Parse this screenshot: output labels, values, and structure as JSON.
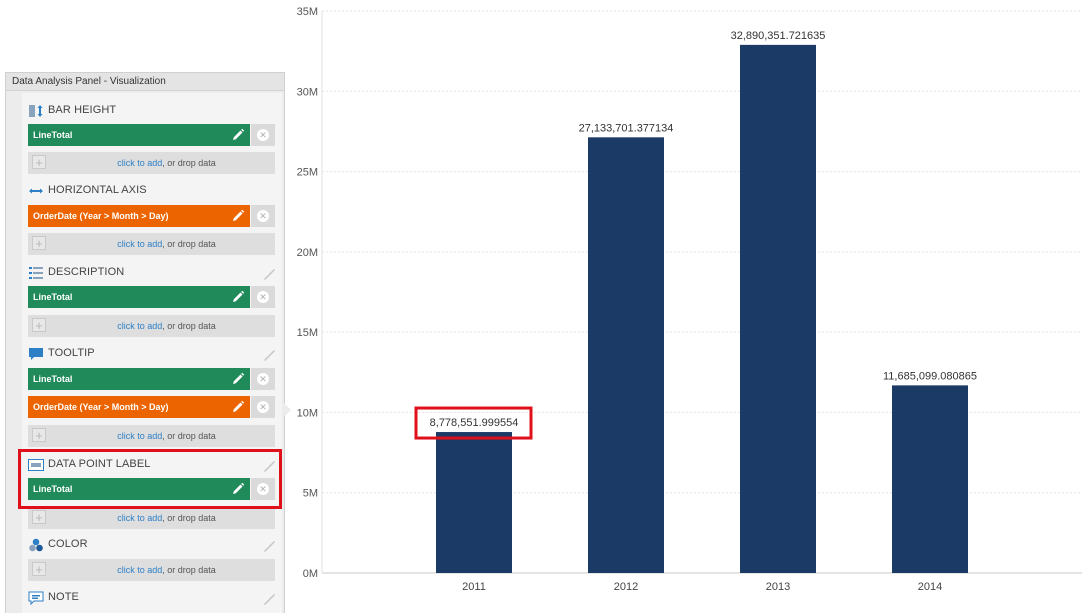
{
  "chart_data": {
    "type": "bar",
    "categories": [
      "2011",
      "2012",
      "2013",
      "2014"
    ],
    "values": [
      8778551.999554,
      27133701.377134,
      32890351.721635,
      11685099.080865
    ],
    "value_labels": [
      "8,778,551.999554",
      "27,133,701.377134",
      "32,890,351.721635",
      "11,685,099.080865"
    ],
    "y_ticks": [
      0,
      5000000,
      10000000,
      15000000,
      20000000,
      25000000,
      30000000,
      35000000
    ],
    "y_tick_labels": [
      "0M",
      "5M",
      "10M",
      "15M",
      "20M",
      "25M",
      "30M",
      "35M"
    ],
    "ylim": [
      0,
      35000000
    ],
    "grid": true,
    "bar_color": "#1c3a66",
    "highlighted_label_index": 0
  },
  "panel": {
    "title": "Data Analysis Panel - Visualization",
    "add_link": "click to add",
    "add_rest": ", or drop data",
    "sections": {
      "bar_height": {
        "label": "BAR HEIGHT",
        "fields": [
          "LineTotal"
        ]
      },
      "horizontal_axis": {
        "label": "HORIZONTAL AXIS",
        "fields": [
          "OrderDate (Year > Month > Day)"
        ]
      },
      "description": {
        "label": "DESCRIPTION",
        "fields": [
          "LineTotal"
        ]
      },
      "tooltip": {
        "label": "TOOLTIP",
        "fields": [
          "LineTotal",
          "OrderDate (Year > Month > Day)"
        ]
      },
      "data_point_label": {
        "label": "DATA POINT LABEL",
        "fields": [
          "LineTotal"
        ]
      },
      "color": {
        "label": "COLOR"
      },
      "note": {
        "label": "NOTE"
      }
    },
    "remove_glyph": "✕",
    "plus_glyph": "+"
  },
  "colors": {
    "measure_pill": "#218a5a",
    "dimension_pill": "#ec6400",
    "highlight": "#e0101a",
    "link": "#2d7fc6"
  }
}
